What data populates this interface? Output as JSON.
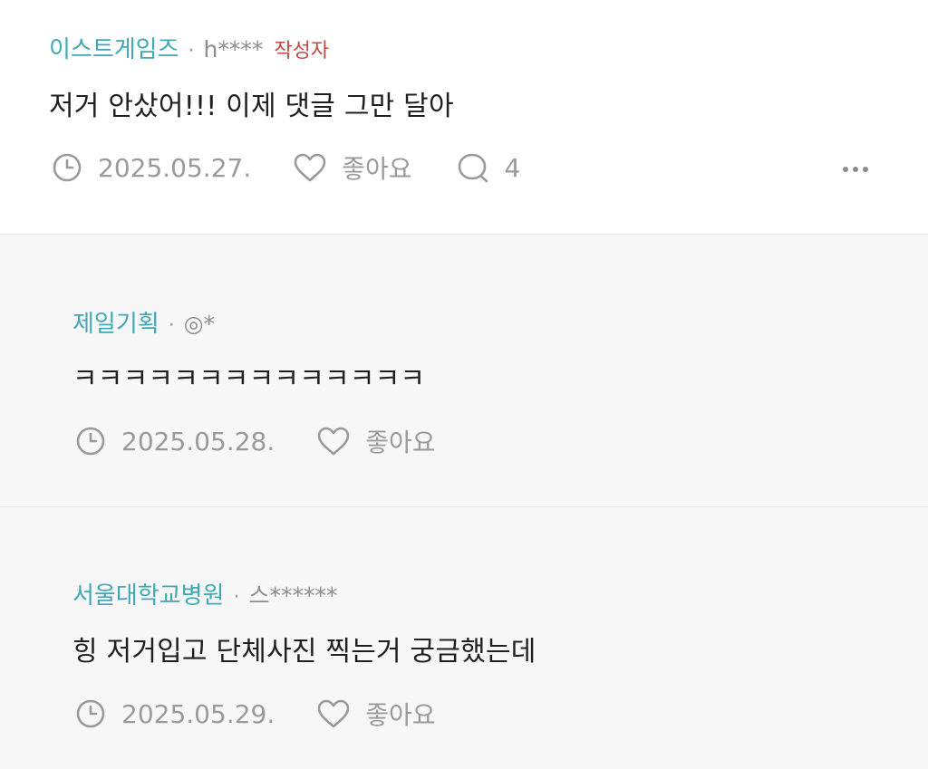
{
  "comments": [
    {
      "company": "이스트게임즈",
      "separator": "·",
      "author": "h****",
      "badge": "작성자",
      "text": "저거 안샀어!!! 이제 댓글 그만 달아",
      "date": "2025.05.27.",
      "like_label": "좋아요",
      "reply_count": "4"
    },
    {
      "company": "제일기획",
      "separator": "·",
      "author": "◎*",
      "text": "ㅋㅋㅋㅋㅋㅋㅋㅋㅋㅋㅋㅋㅋㅋ",
      "date": "2025.05.28.",
      "like_label": "좋아요"
    },
    {
      "company": "서울대학교병원",
      "separator": "·",
      "author": "스******",
      "text": "힝 저거입고 단체사진 찍는거 궁금했는데",
      "date": "2025.05.29.",
      "like_label": "좋아요"
    }
  ],
  "icons": {
    "clock": "clock-icon",
    "heart": "heart-icon",
    "comment": "comment-bubble-icon",
    "more": "more-dots-icon"
  },
  "colors": {
    "company": "#3ea8b6",
    "badge": "#c24a45",
    "muted": "#9a9a9a",
    "reply_bg": "#f7f7f7"
  }
}
